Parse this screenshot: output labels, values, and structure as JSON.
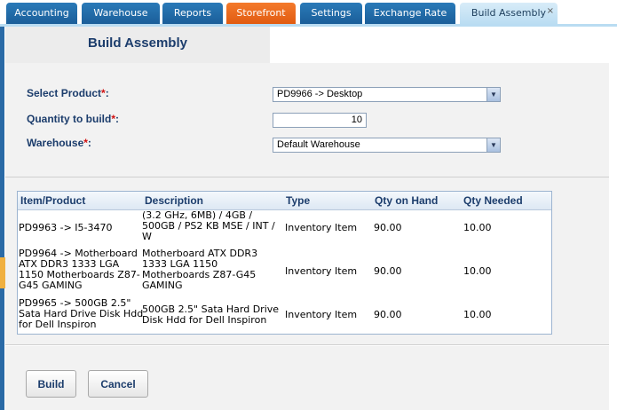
{
  "tabs": [
    {
      "label": "Accounting"
    },
    {
      "label": "Warehouse"
    },
    {
      "label": "Reports"
    },
    {
      "label": "Storefront"
    },
    {
      "label": "Settings"
    },
    {
      "label": "Exchange Rate"
    },
    {
      "label": "Build Assembly",
      "close": "×"
    }
  ],
  "header": {
    "title": "Build Assembly"
  },
  "form": {
    "product_label": "Select Product",
    "product_value": "PD9966 -> Desktop",
    "quantity_label": "Quantity to build",
    "quantity_value": "10",
    "warehouse_label": "Warehouse",
    "warehouse_value": "Default Warehouse",
    "required_mark": "*",
    "colon": ":"
  },
  "grid": {
    "columns": [
      "Item/Product",
      "Description",
      "Type",
      "Qty on Hand",
      "Qty Needed"
    ],
    "rows": [
      {
        "item": [
          "PD9963 -> I5-3470"
        ],
        "description": [
          "(3.2 GHz, 6MB) / 4GB /",
          "500GB / PS2 KB MSE / INT /",
          "W"
        ],
        "type": "Inventory Item",
        "qty_on_hand": "90.00",
        "qty_needed": "10.00"
      },
      {
        "item": [
          "PD9964 -> Motherboard",
          "ATX DDR3 1333 LGA",
          "1150 Motherboards Z87-",
          "G45 GAMING"
        ],
        "description": [
          "Motherboard ATX DDR3",
          "1333 LGA 1150",
          "Motherboards Z87-G45",
          "GAMING"
        ],
        "type": "Inventory Item",
        "qty_on_hand": "90.00",
        "qty_needed": "10.00"
      },
      {
        "item": [
          "PD9965 -> 500GB 2.5\"",
          "Sata Hard Drive Disk Hdd",
          "for Dell Inspiron"
        ],
        "description": [
          "500GB 2.5\" Sata Hard Drive",
          "Disk Hdd for Dell Inspiron"
        ],
        "type": "Inventory Item",
        "qty_on_hand": "90.00",
        "qty_needed": "10.00"
      }
    ]
  },
  "buttons": {
    "build": "Build",
    "cancel": "Cancel"
  },
  "icons": {
    "dropdown": "chevron-down-icon",
    "close": "close-icon"
  },
  "colors": {
    "tab_blue": "#1a5d98",
    "tab_orange": "#e05a10",
    "tab_active": "#b9dcf2",
    "label_blue": "#1c3d6c",
    "required_red": "#d01010"
  }
}
